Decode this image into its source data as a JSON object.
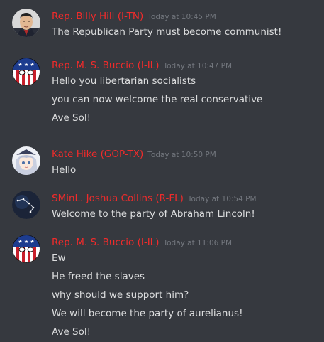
{
  "colors": {
    "background": "#36393f",
    "username": "#f02b2b",
    "timestamp": "#72767d",
    "text": "#dcddde"
  },
  "messages": [
    {
      "avatar_icon": "leader-portrait-avatar-icon",
      "username": "Rep. Billy Hill (I-TN)",
      "timestamp": "Today at 10:45 PM",
      "lines": [
        "The Republican Party must become communist!"
      ]
    },
    {
      "avatar_icon": "flag-ball-avatar-icon",
      "username": "Rep. M. S. Buccio (I-IL)",
      "timestamp": "Today at 10:47 PM",
      "lines": [
        "Hello you libertarian socialists",
        "you can now welcome the real conservative",
        "Ave Sol!"
      ]
    },
    {
      "avatar_icon": "anime-girl-avatar-icon",
      "username": "Kate Hike (GOP-TX)",
      "timestamp": "Today at 10:50 PM",
      "lines": [
        "Hello"
      ]
    },
    {
      "avatar_icon": "constellation-avatar-icon",
      "username": "SMinL. Joshua Collins (R-FL)",
      "timestamp": "Today at 10:54 PM",
      "lines": [
        "Welcome to the party of Abraham Lincoln!"
      ]
    },
    {
      "avatar_icon": "flag-ball-avatar-icon",
      "username": "Rep. M. S. Buccio (I-IL)",
      "timestamp": "Today at 11:06 PM",
      "lines": [
        "Ew",
        "He freed the slaves",
        "why should we support him?",
        "We will become the party of aurelianus!",
        "Ave Sol!"
      ]
    }
  ]
}
